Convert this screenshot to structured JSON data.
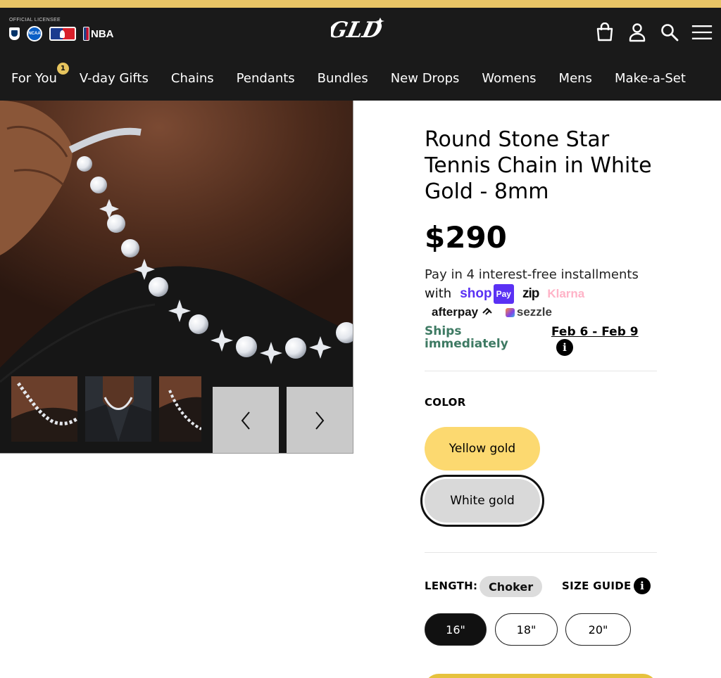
{
  "colors": {
    "header_bg": "#1a1a1a",
    "accent_gold": "#e6c45e",
    "yellow_option": "#fcd970",
    "ships_green": "#3e7a63",
    "shoppay_purple": "#5a31f4",
    "klarna_pink": "#ffb3c7"
  },
  "header": {
    "licensee_label": "OFFICIAL LICENSEE",
    "league_logos": [
      "nfl-logo",
      "ncaa-logo",
      "mlb-logo",
      "nba-logo"
    ],
    "nba_text": "NBA",
    "brand_logo": "GLD",
    "icons": [
      "shopping-bag-icon",
      "account-icon",
      "search-icon",
      "menu-icon"
    ]
  },
  "nav": {
    "items": [
      {
        "label": "For You",
        "badge": "1"
      },
      {
        "label": "V-day Gifts"
      },
      {
        "label": "Chains"
      },
      {
        "label": "Pendants"
      },
      {
        "label": "Bundles"
      },
      {
        "label": "New Drops"
      },
      {
        "label": "Womens"
      },
      {
        "label": "Mens"
      },
      {
        "label": "Make-a-Set"
      }
    ]
  },
  "gallery": {
    "thumbnails": 3,
    "prev_icon": "chevron-left-icon",
    "next_icon": "chevron-right-icon"
  },
  "product": {
    "title": "Round Stone Star Tennis Chain in White Gold - 8mm",
    "price": "$290",
    "installments_text": "Pay in 4 interest-free installments",
    "with_text": "with",
    "payment_providers": {
      "shop": "shop",
      "pay": "Pay",
      "zip": "zip",
      "klarna": "Klarna",
      "afterpay": "afterpay",
      "sezzle": "sezzle"
    },
    "ships_label": "Ships immediately",
    "ships_date": "Feb 6 - Feb 9"
  },
  "color": {
    "label": "COLOR",
    "options": [
      "Yellow gold",
      "White gold"
    ],
    "selected": "White gold"
  },
  "length": {
    "label": "LENGTH:",
    "selected_name": "Choker",
    "size_guide": "SIZE GUIDE",
    "options": [
      "16\"",
      "18\"",
      "20\""
    ],
    "selected": "16\""
  }
}
